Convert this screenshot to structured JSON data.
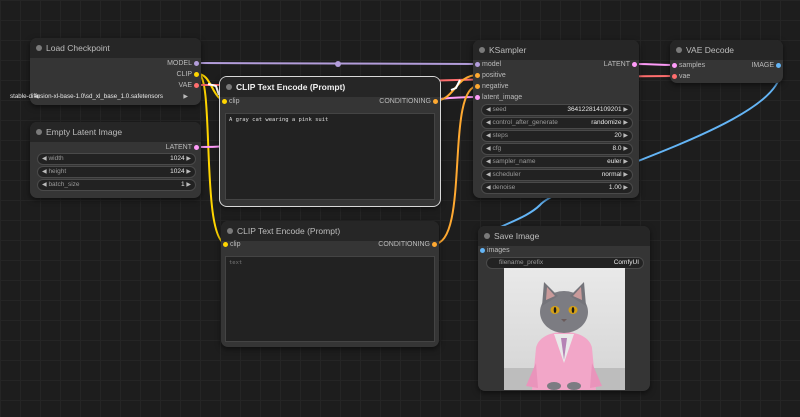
{
  "colors": {
    "model": "#b39ddb",
    "clip": "#ffd500",
    "vae": "#ff6e6e",
    "conditioning": "#ffa931",
    "latent": "#ff9cf9",
    "image": "#64b5f6"
  },
  "nodes": {
    "load_checkpoint": {
      "title": "Load Checkpoint",
      "outputs": [
        "MODEL",
        "CLIP",
        "VAE"
      ],
      "ckpt_name": "stable-diffusion-xl-base-1.0\\sd_xl_base_1.0.safetensors"
    },
    "empty_latent": {
      "title": "Empty Latent Image",
      "output": "LATENT",
      "width_label": "width",
      "width_value": "1024",
      "height_label": "height",
      "height_value": "1024",
      "batch_label": "batch_size",
      "batch_value": "1"
    },
    "clip_positive": {
      "title": "CLIP Text Encode (Prompt)",
      "input": "clip",
      "output": "CONDITIONING",
      "text": "A gray cat wearing a pink suit"
    },
    "clip_negative": {
      "title": "CLIP Text Encode (Prompt)",
      "input": "clip",
      "output": "CONDITIONING",
      "placeholder": "text"
    },
    "ksampler": {
      "title": "KSampler",
      "inputs": [
        "model",
        "positive",
        "negative",
        "latent_image"
      ],
      "output": "LATENT",
      "widgets": [
        {
          "label": "seed",
          "value": "364122814109201"
        },
        {
          "label": "control_after_generate",
          "value": "randomize"
        },
        {
          "label": "steps",
          "value": "20"
        },
        {
          "label": "cfg",
          "value": "8.0"
        },
        {
          "label": "sampler_name",
          "value": "euler"
        },
        {
          "label": "scheduler",
          "value": "normal"
        },
        {
          "label": "denoise",
          "value": "1.00"
        }
      ]
    },
    "vae_decode": {
      "title": "VAE Decode",
      "inputs": [
        "samples",
        "vae"
      ],
      "output": "IMAGE"
    },
    "save_image": {
      "title": "Save Image",
      "input": "images",
      "prefix_label": "filename_prefix",
      "prefix_value": "ComfyUI"
    }
  }
}
